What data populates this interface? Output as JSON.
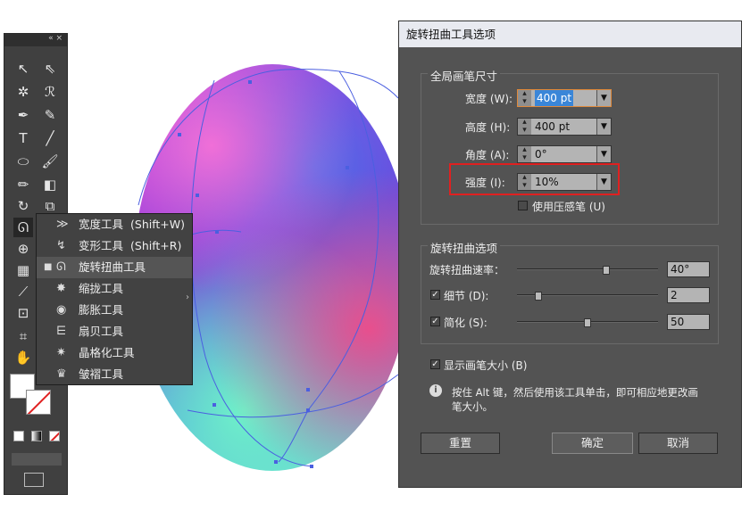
{
  "toolbox": {
    "top_controls": "« ×",
    "tools": [
      "selection-tool-icon",
      "direct-selection-tool-icon",
      "magic-wand-icon",
      "lasso-icon",
      "pen-icon",
      "curvature-icon",
      "type-icon",
      "line-icon",
      "ellipse-icon",
      "paintbrush-icon",
      "pencil-icon",
      "eraser-icon",
      "rotate-icon",
      "scale-icon",
      "warp-icon",
      "free-transform-icon",
      "symbol-sprayer-icon",
      "eyedropper-icon",
      "graph-icon",
      "artboard-icon",
      "hand-icon",
      "zoom-icon"
    ]
  },
  "flyout": {
    "items": [
      {
        "label": "宽度工具",
        "shortcut": "(Shift+W)",
        "icon": "width-tool-icon"
      },
      {
        "label": "变形工具",
        "shortcut": "(Shift+R)",
        "icon": "warp-tool-icon"
      },
      {
        "label": "旋转扭曲工具",
        "shortcut": "",
        "icon": "twirl-tool-icon",
        "selected": true
      },
      {
        "label": "缩拢工具",
        "shortcut": "",
        "icon": "pucker-tool-icon"
      },
      {
        "label": "膨胀工具",
        "shortcut": "",
        "icon": "bloat-tool-icon"
      },
      {
        "label": "扇贝工具",
        "shortcut": "",
        "icon": "scallop-tool-icon"
      },
      {
        "label": "晶格化工具",
        "shortcut": "",
        "icon": "crystallize-tool-icon"
      },
      {
        "label": "皱褶工具",
        "shortcut": "",
        "icon": "wrinkle-tool-icon"
      }
    ],
    "selected_bullet": "■",
    "arrow": "›"
  },
  "dialog": {
    "title": "旋转扭曲工具选项",
    "global": {
      "legend": "全局画笔尺寸",
      "width_label": "宽度 (W):",
      "width_value": "400 pt",
      "height_label": "高度 (H):",
      "height_value": "400 pt",
      "angle_label": "角度 (A):",
      "angle_value": "0°",
      "intensity_label": "强度 (I):",
      "intensity_value": "10%",
      "pressure_label": "使用压感笔 (U)",
      "pressure_checked": false
    },
    "twirl": {
      "legend": "旋转扭曲选项",
      "rate_label": "旋转扭曲速率：",
      "rate_value": "40°",
      "rate_fraction": 0.64,
      "detail_label": "细节 (D):",
      "detail_value": "2",
      "detail_checked": true,
      "detail_fraction": 0.13,
      "simplify_label": "简化 (S):",
      "simplify_value": "50",
      "simplify_checked": true,
      "simplify_fraction": 0.5
    },
    "show_brush_label": "显示画笔大小 (B)",
    "show_brush_checked": true,
    "info_text_line1": "按住 Alt 键，然后使用该工具单击，即可相应地更改画",
    "info_text_line2": "笔大小。",
    "buttons": {
      "reset": "重置",
      "ok": "确定",
      "cancel": "取消"
    }
  },
  "colors": {
    "highlight_box": "#e02020",
    "field_focus": "#e0893a",
    "selection": "#3a86d8"
  }
}
